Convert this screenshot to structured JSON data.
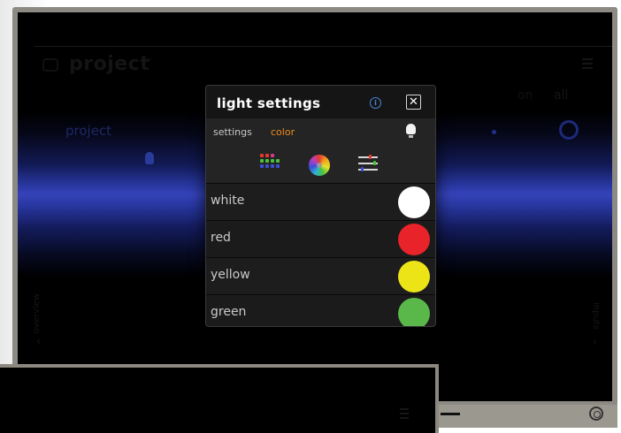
{
  "background": {
    "title": "project",
    "band_label": "project",
    "tab_on": "on",
    "tab_all": "all",
    "side_left_label": "overview",
    "side_right_label": "inputs"
  },
  "dialog": {
    "title": "light settings",
    "info_symbol": "i",
    "close_symbol": "✕",
    "tabs": [
      {
        "label": "settings",
        "active": false
      },
      {
        "label": "color",
        "active": true
      }
    ],
    "mode_icons": [
      "palette-grid-icon",
      "color-wheel-icon",
      "sliders-icon",
      "bulb-icon"
    ],
    "colors": [
      {
        "name": "white",
        "hex": "#ffffff"
      },
      {
        "name": "red",
        "hex": "#e8232a"
      },
      {
        "name": "yellow",
        "hex": "#ede418"
      },
      {
        "name": "green",
        "hex": "#5ab84a"
      }
    ]
  },
  "accent_colors": {
    "active_tab": "#f08a1c",
    "info_icon": "#4a86d8"
  }
}
